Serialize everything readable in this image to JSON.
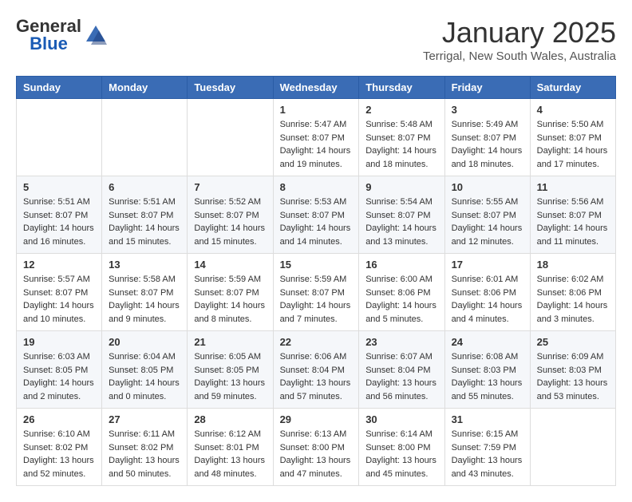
{
  "header": {
    "logo_line1": "General",
    "logo_line2": "Blue",
    "month": "January 2025",
    "location": "Terrigal, New South Wales, Australia"
  },
  "weekdays": [
    "Sunday",
    "Monday",
    "Tuesday",
    "Wednesday",
    "Thursday",
    "Friday",
    "Saturday"
  ],
  "weeks": [
    [
      {
        "day": "",
        "info": ""
      },
      {
        "day": "",
        "info": ""
      },
      {
        "day": "",
        "info": ""
      },
      {
        "day": "1",
        "info": "Sunrise: 5:47 AM\nSunset: 8:07 PM\nDaylight: 14 hours\nand 19 minutes."
      },
      {
        "day": "2",
        "info": "Sunrise: 5:48 AM\nSunset: 8:07 PM\nDaylight: 14 hours\nand 18 minutes."
      },
      {
        "day": "3",
        "info": "Sunrise: 5:49 AM\nSunset: 8:07 PM\nDaylight: 14 hours\nand 18 minutes."
      },
      {
        "day": "4",
        "info": "Sunrise: 5:50 AM\nSunset: 8:07 PM\nDaylight: 14 hours\nand 17 minutes."
      }
    ],
    [
      {
        "day": "5",
        "info": "Sunrise: 5:51 AM\nSunset: 8:07 PM\nDaylight: 14 hours\nand 16 minutes."
      },
      {
        "day": "6",
        "info": "Sunrise: 5:51 AM\nSunset: 8:07 PM\nDaylight: 14 hours\nand 15 minutes."
      },
      {
        "day": "7",
        "info": "Sunrise: 5:52 AM\nSunset: 8:07 PM\nDaylight: 14 hours\nand 15 minutes."
      },
      {
        "day": "8",
        "info": "Sunrise: 5:53 AM\nSunset: 8:07 PM\nDaylight: 14 hours\nand 14 minutes."
      },
      {
        "day": "9",
        "info": "Sunrise: 5:54 AM\nSunset: 8:07 PM\nDaylight: 14 hours\nand 13 minutes."
      },
      {
        "day": "10",
        "info": "Sunrise: 5:55 AM\nSunset: 8:07 PM\nDaylight: 14 hours\nand 12 minutes."
      },
      {
        "day": "11",
        "info": "Sunrise: 5:56 AM\nSunset: 8:07 PM\nDaylight: 14 hours\nand 11 minutes."
      }
    ],
    [
      {
        "day": "12",
        "info": "Sunrise: 5:57 AM\nSunset: 8:07 PM\nDaylight: 14 hours\nand 10 minutes."
      },
      {
        "day": "13",
        "info": "Sunrise: 5:58 AM\nSunset: 8:07 PM\nDaylight: 14 hours\nand 9 minutes."
      },
      {
        "day": "14",
        "info": "Sunrise: 5:59 AM\nSunset: 8:07 PM\nDaylight: 14 hours\nand 8 minutes."
      },
      {
        "day": "15",
        "info": "Sunrise: 5:59 AM\nSunset: 8:07 PM\nDaylight: 14 hours\nand 7 minutes."
      },
      {
        "day": "16",
        "info": "Sunrise: 6:00 AM\nSunset: 8:06 PM\nDaylight: 14 hours\nand 5 minutes."
      },
      {
        "day": "17",
        "info": "Sunrise: 6:01 AM\nSunset: 8:06 PM\nDaylight: 14 hours\nand 4 minutes."
      },
      {
        "day": "18",
        "info": "Sunrise: 6:02 AM\nSunset: 8:06 PM\nDaylight: 14 hours\nand 3 minutes."
      }
    ],
    [
      {
        "day": "19",
        "info": "Sunrise: 6:03 AM\nSunset: 8:05 PM\nDaylight: 14 hours\nand 2 minutes."
      },
      {
        "day": "20",
        "info": "Sunrise: 6:04 AM\nSunset: 8:05 PM\nDaylight: 14 hours\nand 0 minutes."
      },
      {
        "day": "21",
        "info": "Sunrise: 6:05 AM\nSunset: 8:05 PM\nDaylight: 13 hours\nand 59 minutes."
      },
      {
        "day": "22",
        "info": "Sunrise: 6:06 AM\nSunset: 8:04 PM\nDaylight: 13 hours\nand 57 minutes."
      },
      {
        "day": "23",
        "info": "Sunrise: 6:07 AM\nSunset: 8:04 PM\nDaylight: 13 hours\nand 56 minutes."
      },
      {
        "day": "24",
        "info": "Sunrise: 6:08 AM\nSunset: 8:03 PM\nDaylight: 13 hours\nand 55 minutes."
      },
      {
        "day": "25",
        "info": "Sunrise: 6:09 AM\nSunset: 8:03 PM\nDaylight: 13 hours\nand 53 minutes."
      }
    ],
    [
      {
        "day": "26",
        "info": "Sunrise: 6:10 AM\nSunset: 8:02 PM\nDaylight: 13 hours\nand 52 minutes."
      },
      {
        "day": "27",
        "info": "Sunrise: 6:11 AM\nSunset: 8:02 PM\nDaylight: 13 hours\nand 50 minutes."
      },
      {
        "day": "28",
        "info": "Sunrise: 6:12 AM\nSunset: 8:01 PM\nDaylight: 13 hours\nand 48 minutes."
      },
      {
        "day": "29",
        "info": "Sunrise: 6:13 AM\nSunset: 8:00 PM\nDaylight: 13 hours\nand 47 minutes."
      },
      {
        "day": "30",
        "info": "Sunrise: 6:14 AM\nSunset: 8:00 PM\nDaylight: 13 hours\nand 45 minutes."
      },
      {
        "day": "31",
        "info": "Sunrise: 6:15 AM\nSunset: 7:59 PM\nDaylight: 13 hours\nand 43 minutes."
      },
      {
        "day": "",
        "info": ""
      }
    ]
  ]
}
